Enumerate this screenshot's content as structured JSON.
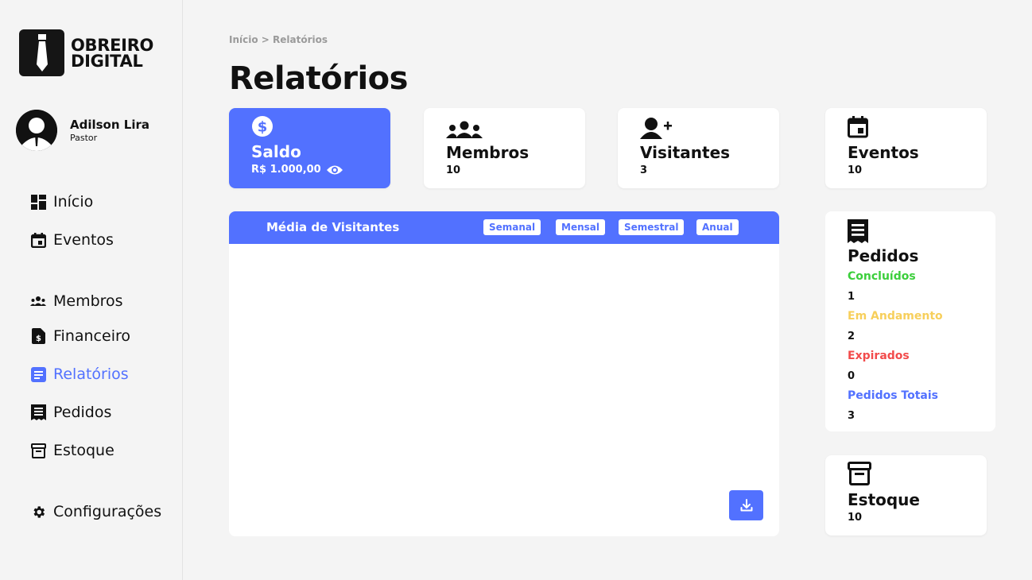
{
  "brand": {
    "line1": "OBREIRO",
    "line2": "DIGITAL"
  },
  "user": {
    "name": "Adilson Lira",
    "role": "Pastor"
  },
  "nav": {
    "inicio": "Início",
    "eventos": "Eventos",
    "membros": "Membros",
    "financeiro": "Financeiro",
    "relatorios": "Relatórios",
    "pedidos": "Pedidos",
    "estoque": "Estoque",
    "configuracoes": "Configurações"
  },
  "breadcrumb": "Início > Relatórios",
  "page_title": "Relatórios",
  "cards": {
    "saldo": {
      "title": "Saldo",
      "value": "R$ 1.000,00"
    },
    "membros": {
      "title": "Membros",
      "value": "10"
    },
    "visitantes": {
      "title": "Visitantes",
      "value": "3"
    },
    "eventos": {
      "title": "Eventos",
      "value": "10"
    },
    "estoque": {
      "title": "Estoque",
      "value": "10"
    }
  },
  "chart_panel": {
    "title": "Média de Visitantes",
    "periods": [
      "Semanal",
      "Mensal",
      "Semestral",
      "Anual"
    ]
  },
  "pedidos": {
    "title": "Pedidos",
    "concluidos_label": "Concluídos",
    "concluidos_value": "1",
    "andamento_label": "Em Andamento",
    "andamento_value": "2",
    "expirados_label": "Expirados",
    "expirados_value": "0",
    "totais_label": "Pedidos Totais",
    "totais_value": "3"
  },
  "colors": {
    "accent": "#5271ff",
    "success": "#3ccf3c",
    "warning": "#f7cf5b",
    "danger": "#f24b4b"
  }
}
